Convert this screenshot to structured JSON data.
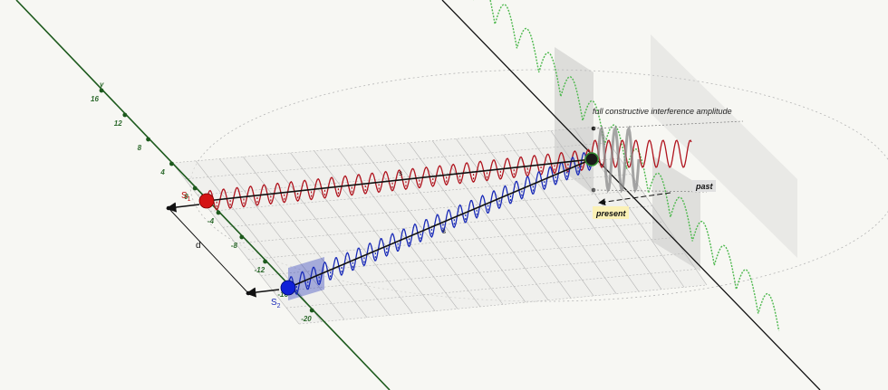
{
  "labels": {
    "source1_main": "S",
    "source1_sub": "1",
    "source2_main": "S",
    "source2_sub": "2",
    "separation": "d",
    "path1": "s",
    "path2": "s",
    "y_axis": "y",
    "amplitude_note": "full constructive interference amplitude",
    "past": "past",
    "present": "present"
  },
  "y_axis_ticks": [
    "16",
    "12",
    "8",
    "4",
    "0",
    "-4",
    "-8",
    "-12",
    "-16",
    "-20"
  ],
  "colors": {
    "background": "#f7f7f3",
    "source1_wave": "#b0141e",
    "source2_wave": "#1a2bb8",
    "axis_green": "#2e6b2e",
    "screen_wave": "#4db84d",
    "present_badge": "#fbf1b6"
  }
}
